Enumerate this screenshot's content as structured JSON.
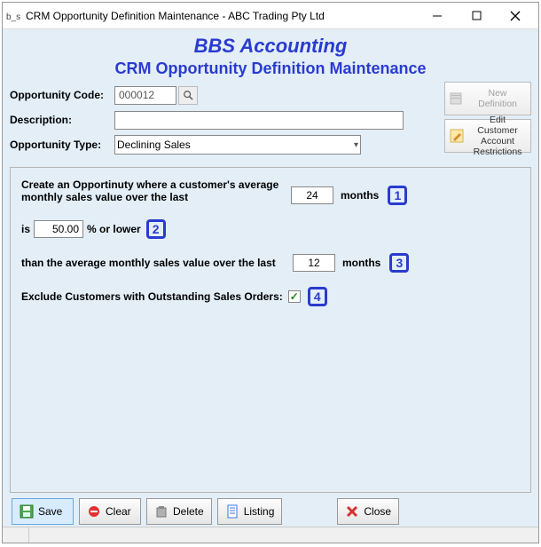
{
  "window": {
    "title": "CRM Opportunity Definition Maintenance - ABC Trading Pty Ltd"
  },
  "header": {
    "brand": "BBS Accounting",
    "title": "CRM Opportunity Definition Maintenance"
  },
  "form": {
    "oppcode_label": "Opportunity Code:",
    "oppcode_value": "000012",
    "description_label": "Description:",
    "description_value": "",
    "opptype_label": "Opportunity Type:",
    "opptype_value": "Declining Sales"
  },
  "right_buttons": {
    "newdef": "New Definition",
    "editcust": "Edit Customer Account Restrictions"
  },
  "config": {
    "line1_a": "Create an Opportinuty where a customer's average",
    "line1_b": "monthly sales value over the last",
    "months1_value": "24",
    "months_word": "months",
    "marker1": "1",
    "is_word": "is",
    "percent_value": "50.00",
    "percent_suffix": "% or lower",
    "marker2": "2",
    "line3": "than the average monthly sales value over the last",
    "months2_value": "12",
    "marker3": "3",
    "exclude_label": "Exclude Customers with Outstanding Sales Orders:",
    "exclude_checked": "✓",
    "marker4": "4"
  },
  "buttons": {
    "save": "Save",
    "clear": "Clear",
    "delete": "Delete",
    "listing": "Listing",
    "close": "Close"
  }
}
